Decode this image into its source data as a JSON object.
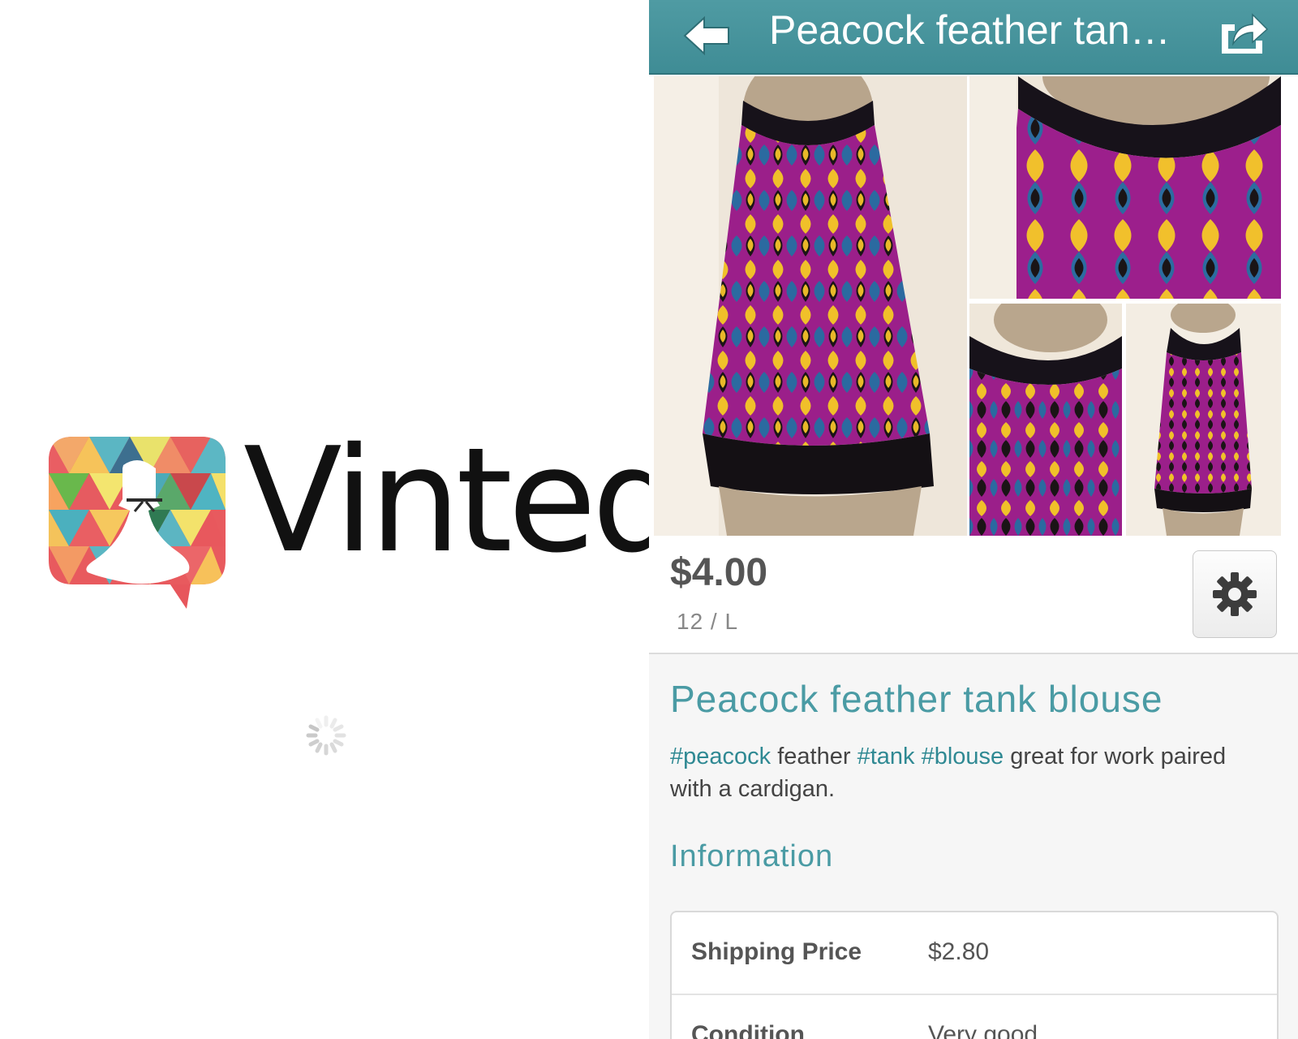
{
  "splash": {
    "brand_name": "Vinted",
    "logo_icon": "vinted-dress-speech-bubble-logo",
    "loading_icon": "loading-spinner-icon"
  },
  "navbar": {
    "title": "Peacock feather tan…",
    "back_icon": "back-arrow-icon",
    "share_icon": "share-icon",
    "background_color": "#4a9aa3"
  },
  "gallery": {
    "photos": [
      {
        "alt": "main-photo"
      },
      {
        "alt": "closeup-photo"
      },
      {
        "alt": "side-photo"
      },
      {
        "alt": "full-photo"
      }
    ]
  },
  "item": {
    "price": "$4.00",
    "size": "12 / L",
    "settings_icon": "gear-icon",
    "title": "Peacock feather tank blouse",
    "description": {
      "tag_1": "#peacock",
      "text_1": " feather ",
      "tag_2": "#tank",
      "text_2": " ",
      "tag_3": "#blouse",
      "text_3": " great for work paired with a cardigan."
    }
  },
  "information": {
    "heading": "Information",
    "rows": [
      {
        "label": "Shipping Price",
        "value": "$2.80"
      },
      {
        "label": "Condition",
        "value": "Very good"
      }
    ]
  },
  "colors": {
    "accent": "#4a9ba4",
    "tag": "#2f8993"
  }
}
